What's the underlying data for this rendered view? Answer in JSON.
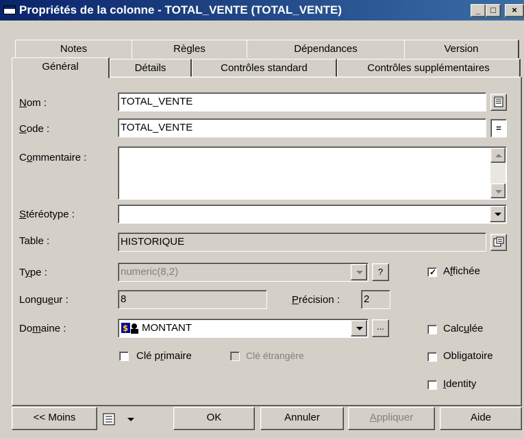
{
  "window": {
    "title": "Propriétés de la colonne - TOTAL_VENTE (TOTAL_VENTE)",
    "minimize": "_",
    "maximize": "□",
    "close": "×"
  },
  "tabs_back": [
    "Notes",
    "Règles",
    "Dépendances",
    "Version"
  ],
  "tabs_front": [
    "Général",
    "Détails",
    "Contrôles standard",
    "Contrôles supplémentaires"
  ],
  "active_tab": "Général",
  "form": {
    "nom": {
      "label_u": "N",
      "label_rest": "om :",
      "value": "TOTAL_VENTE"
    },
    "code": {
      "label_u": "C",
      "label_rest": "ode :",
      "value": "TOTAL_VENTE",
      "btn": "="
    },
    "commentaire": {
      "label_pre": "C",
      "label_u": "o",
      "label_rest": "mmentaire :",
      "value": ""
    },
    "stereotype": {
      "label_u": "S",
      "label_rest": "téréotype :",
      "value": ""
    },
    "table": {
      "label": "Table :",
      "value": "HISTORIQUE"
    },
    "type": {
      "label_pre": "T",
      "label_u": "y",
      "label_rest": "pe :",
      "value": "numeric(8,2)",
      "help": "?"
    },
    "longueur": {
      "label_pre": "Longu",
      "label_u": "e",
      "label_rest": "ur :",
      "value": "8"
    },
    "precision": {
      "label_u": "P",
      "label_rest": "récision :",
      "value": "2"
    },
    "domaine": {
      "label_pre": "Do",
      "label_u": "m",
      "label_rest": "aine :",
      "value": "MONTANT",
      "ellipsis": "..."
    }
  },
  "checkboxes": {
    "affichee": {
      "pre": "A",
      "u": "f",
      "rest": "fichée",
      "checked": true
    },
    "calculee": {
      "pre": "Calc",
      "u": "u",
      "rest": "lée",
      "checked": false
    },
    "obligatoire": {
      "pre": "Obli",
      "u": "g",
      "rest": "atoire",
      "checked": false
    },
    "identity": {
      "pre": "",
      "u": "I",
      "rest": "dentity",
      "checked": false
    },
    "cle_primaire": {
      "pre": "Clé p",
      "u": "r",
      "rest": "imaire",
      "checked": false
    },
    "cle_etrangere": {
      "label": "Clé étrangère",
      "checked": false,
      "disabled": true
    }
  },
  "footer": {
    "moins": "<< Moins",
    "ok": "OK",
    "annuler": "Annuler",
    "appliquer_u": "A",
    "appliquer_rest": "ppliquer",
    "aide": "Aide"
  },
  "icons": [
    "app-icon",
    "properties-icon",
    "list-menu-icon",
    "domain-icon",
    "dropdown-arrow-icon"
  ]
}
